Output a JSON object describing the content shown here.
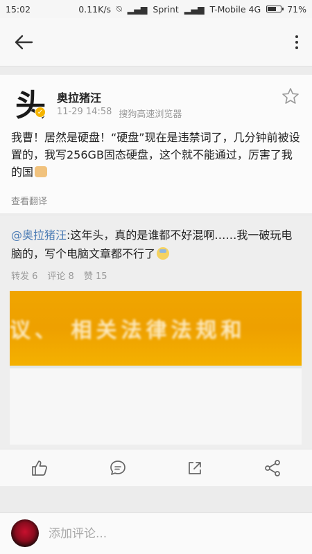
{
  "status_bar": {
    "time": "15:02",
    "speed": "0.11K/s",
    "carrier1": "Sprint",
    "carrier2": "T-Mobile 4G",
    "battery": "71%",
    "battery_level": 0.71
  },
  "app_bar": {
    "back_icon": "arrow-left",
    "more_icon": "vertical-dots"
  },
  "post": {
    "avatar_char": "头",
    "username": "奥拉猪汪",
    "date": "11-29 14:58",
    "source": "搜狗高速浏览器",
    "text": "我曹！居然是硬盘！“硬盘”现在是违禁词了，几分钟前被设置的，我写256GB固态硬盘，这个就不能通过，厉害了我的国",
    "translate_label": "查看翻译"
  },
  "repost": {
    "mention": "@奥拉猪汪",
    "text": ":这年头，真的是谁都不好混啊……我一破玩电脑的，写个电脑文章都不行了",
    "reposts": "转发 6",
    "comments": "评论 8",
    "likes": "赞 15",
    "image_text": "议、 相关法律法规和"
  },
  "actions": {
    "like_icon": "thumbs-up",
    "comment_icon": "speech-bubble",
    "repost_icon": "arrow-out-box",
    "share_icon": "share-nodes"
  },
  "comment": {
    "placeholder": "添加评论..."
  },
  "colors": {
    "accent_link": "#4a7bb4",
    "banner": "#f0a500",
    "verified": "#f5b400"
  }
}
